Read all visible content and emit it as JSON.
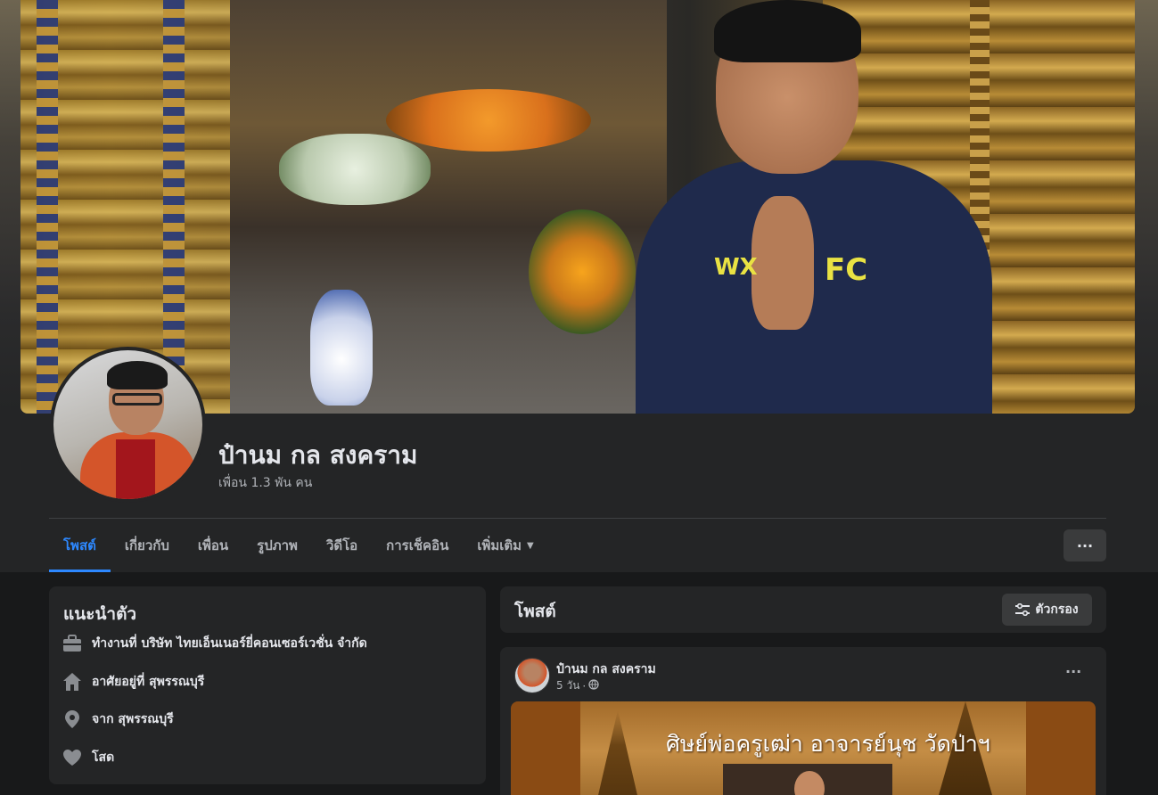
{
  "profile": {
    "name": "ป๋านม กล สงคราม",
    "friends": "เพื่อน 1.3 พัน คน"
  },
  "tabs": [
    {
      "label": "โพสต์",
      "active": true
    },
    {
      "label": "เกี่ยวกับ",
      "active": false
    },
    {
      "label": "เพื่อน",
      "active": false
    },
    {
      "label": "รูปภาพ",
      "active": false
    },
    {
      "label": "วิดีโอ",
      "active": false
    },
    {
      "label": "การเช็คอิน",
      "active": false
    },
    {
      "label": "เพิ่มเติม",
      "active": false
    }
  ],
  "more_menu": "···",
  "intro": {
    "title": "แนะนำตัว",
    "items": [
      {
        "icon": "briefcase-icon",
        "text": "ทำงานที่ บริษัท ไทยเอ็นเนอร์ยี่คอนเซอร์เวชั่น จำกัด"
      },
      {
        "icon": "home-icon",
        "text": "อาศัยอยู่ที่ สุพรรณบุรี"
      },
      {
        "icon": "location-pin-icon",
        "text": "จาก สุพรรณบุรี"
      },
      {
        "icon": "heart-icon",
        "text": "โสด"
      }
    ]
  },
  "posts_section": {
    "title": "โพสต์",
    "filter_label": "ตัวกรอง"
  },
  "post": {
    "author": "ป๋านม กล สงคราม",
    "time": "5 วัน",
    "separator": "·",
    "privacy_icon": "globe-icon",
    "menu": "···",
    "image_text": "ศิษย์พ่อครูเฒ่า อาจารย์นุช วัดป่าฯ"
  },
  "cover": {
    "shirt_text": "FC",
    "logo_text": "WX"
  },
  "colors": {
    "accent": "#2d88ff",
    "card": "#242526",
    "page_bg": "#18191a",
    "button": "#3a3b3c"
  }
}
